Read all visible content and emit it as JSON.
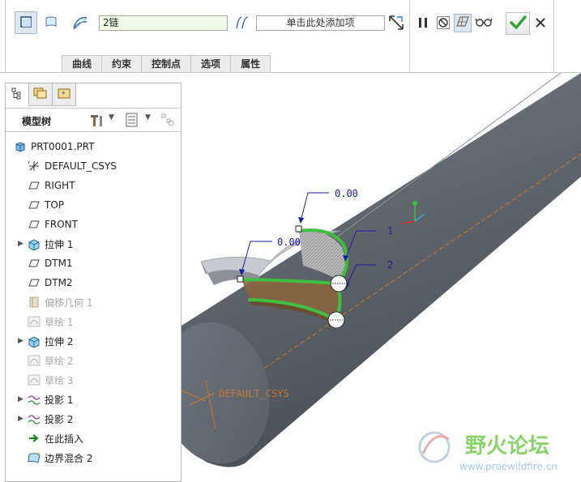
{
  "dashboard": {
    "chain_field_value": "2链",
    "add_item_placeholder": "单击此处添加项",
    "tabs": [
      "曲线",
      "约束",
      "控制点",
      "选项",
      "属性"
    ]
  },
  "navigator": {
    "tree_title": "模型树",
    "items": [
      {
        "label": "PRT0001.PRT",
        "icon": "part-icon",
        "expandable": false,
        "dimmed": false
      },
      {
        "label": "DEFAULT_CSYS",
        "icon": "csys-icon",
        "expandable": false,
        "dimmed": false
      },
      {
        "label": "RIGHT",
        "icon": "datum-plane-icon",
        "expandable": false,
        "dimmed": false
      },
      {
        "label": "TOP",
        "icon": "datum-plane-icon",
        "expandable": false,
        "dimmed": false
      },
      {
        "label": "FRONT",
        "icon": "datum-plane-icon",
        "expandable": false,
        "dimmed": false
      },
      {
        "label": "拉伸 1",
        "icon": "extrude-icon",
        "expandable": true,
        "dimmed": false
      },
      {
        "label": "DTM1",
        "icon": "datum-plane-icon",
        "expandable": false,
        "dimmed": false
      },
      {
        "label": "DTM2",
        "icon": "datum-plane-icon",
        "expandable": false,
        "dimmed": false
      },
      {
        "label": "偏移几何 1",
        "icon": "offset-geometry-icon",
        "expandable": false,
        "dimmed": true
      },
      {
        "label": "草绘 1",
        "icon": "sketch-icon",
        "expandable": false,
        "dimmed": true
      },
      {
        "label": "拉伸 2",
        "icon": "extrude-icon",
        "expandable": true,
        "dimmed": false
      },
      {
        "label": "草绘 2",
        "icon": "sketch-icon",
        "expandable": false,
        "dimmed": true
      },
      {
        "label": "草绘 3",
        "icon": "sketch-icon",
        "expandable": false,
        "dimmed": true
      },
      {
        "label": "投影 1",
        "icon": "projection-icon",
        "expandable": true,
        "dimmed": false
      },
      {
        "label": "投影 2",
        "icon": "projection-icon",
        "expandable": true,
        "dimmed": false
      },
      {
        "label": "在此插入",
        "icon": "insert-here-arrow-icon",
        "expandable": false,
        "dimmed": false
      },
      {
        "label": "边界混合 2",
        "icon": "boundary-blend-icon",
        "expandable": false,
        "dimmed": false
      }
    ]
  },
  "viewport": {
    "dim_label_1": "0.00",
    "dim_label_2": "0.00",
    "chain_label_1": "1",
    "chain_label_2": "2",
    "csys_label": "DEFAULT_CSYS",
    "watermark_title": "野火论坛",
    "watermark_url": "www.proewildfire.cn"
  },
  "colors": {
    "accent_green": "#3fbf3f",
    "chain_field_bg": "#f0fae6",
    "model_grey": "#5a5f66",
    "annotation_blue": "#1a1aa0",
    "watermark_green": "#7ccf5a"
  }
}
